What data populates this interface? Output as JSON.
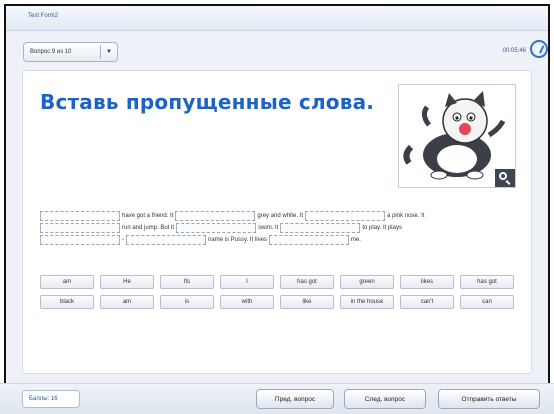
{
  "window": {
    "title": "Test Form2"
  },
  "question_selector": {
    "label": "Вопрос 9 из 10",
    "arrow": "▼"
  },
  "timer": {
    "value": "00:05:46"
  },
  "task": {
    "heading": "Вставь пропущенные слова."
  },
  "sentence": {
    "line1": [
      "have got a friend. It",
      "grey and white. It",
      "a pink nose. It"
    ],
    "line2": [
      "run and jump. But it",
      "swim. It",
      "to play. It plays"
    ],
    "line3": [
      "-",
      "name is Pussy. It lives",
      "me."
    ]
  },
  "word_bank": [
    [
      "am",
      "He",
      "Its",
      "I",
      "has got",
      "green",
      "likes",
      "has got"
    ],
    [
      "black",
      "am",
      "is",
      "with",
      "like",
      "in the house",
      "can't",
      "can"
    ]
  ],
  "footer": {
    "score": "Баллы: 16",
    "prev_button": "Пред. вопрос",
    "next_button": "След. вопрос",
    "submit_button": "Отправить ответы"
  }
}
